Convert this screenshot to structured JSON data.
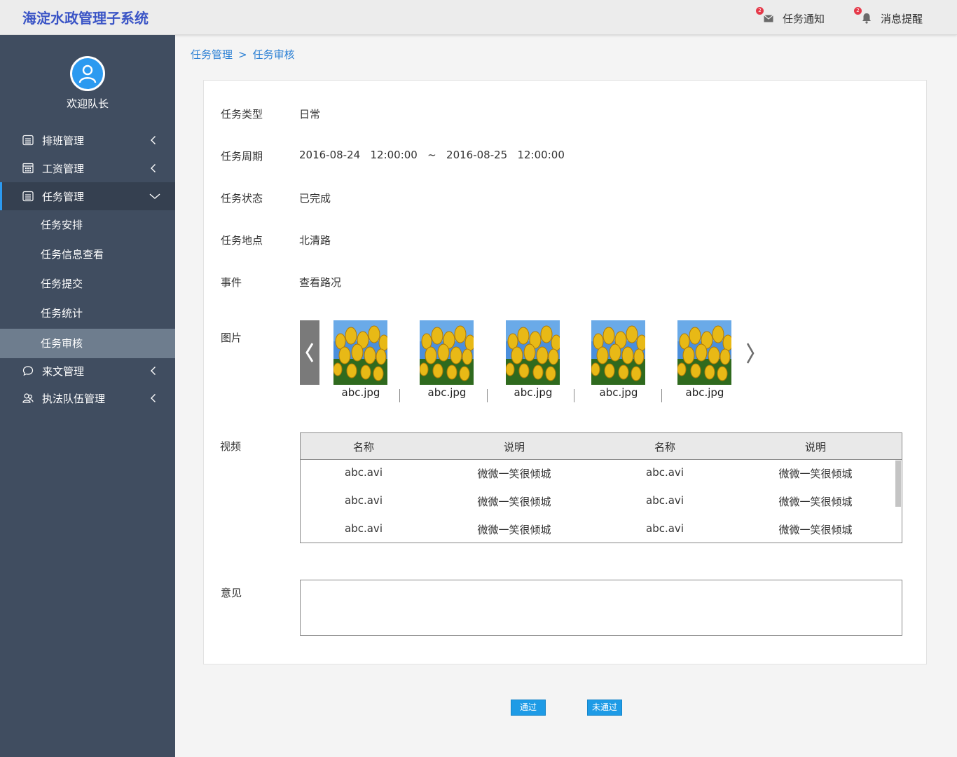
{
  "header": {
    "logo": "海淀水政管理子系统",
    "notify_label": "任务通知",
    "notify_count": "2",
    "message_label": "消息提醒",
    "message_count": "2"
  },
  "sidebar": {
    "welcome": "欢迎队长",
    "menu": [
      {
        "label": "排班管理",
        "icon": "schedule-icon"
      },
      {
        "label": "工资管理",
        "icon": "salary-icon"
      },
      {
        "label": "任务管理",
        "icon": "task-icon"
      },
      {
        "label": "来文管理",
        "icon": "chat-icon"
      },
      {
        "label": "执法队伍管理",
        "icon": "team-icon"
      }
    ],
    "submenu": [
      "任务安排",
      "任务信息查看",
      "任务提交",
      "任务统计",
      "任务审核"
    ]
  },
  "breadcrumb": {
    "parent": "任务管理",
    "separator": ">",
    "current": "任务审核"
  },
  "form": {
    "type_label": "任务类型",
    "type_value": "日常",
    "period_label": "任务周期",
    "period_value": "2016-08-24   12:00:00   ~   2016-08-25   12:00:00",
    "status_label": "任务状态",
    "status_value": "已完成",
    "location_label": "任务地点",
    "location_value": "北清路",
    "event_label": "事件",
    "event_value": "查看路况",
    "images_label": "图片",
    "images": [
      "abc.jpg",
      "abc.jpg",
      "abc.jpg",
      "abc.jpg",
      "abc.jpg"
    ],
    "video_label": "视频",
    "opinion_label": "意见"
  },
  "video_table": {
    "headers": [
      "名称",
      "说明",
      "名称",
      "说明"
    ],
    "rows": [
      [
        "abc.avi",
        "微微一笑很倾城",
        "abc.avi",
        "微微一笑很倾城"
      ],
      [
        "abc.avi",
        "微微一笑很倾城",
        "abc.avi",
        "微微一笑很倾城"
      ],
      [
        "abc.avi",
        "微微一笑很倾城",
        "abc.avi",
        "微微一笑很倾城"
      ]
    ]
  },
  "buttons": {
    "pass": "通过",
    "reject": "未通过"
  },
  "colors": {
    "accent": "#1e9be6",
    "sidebar": "#404d60",
    "link": "#2a7fd4"
  }
}
